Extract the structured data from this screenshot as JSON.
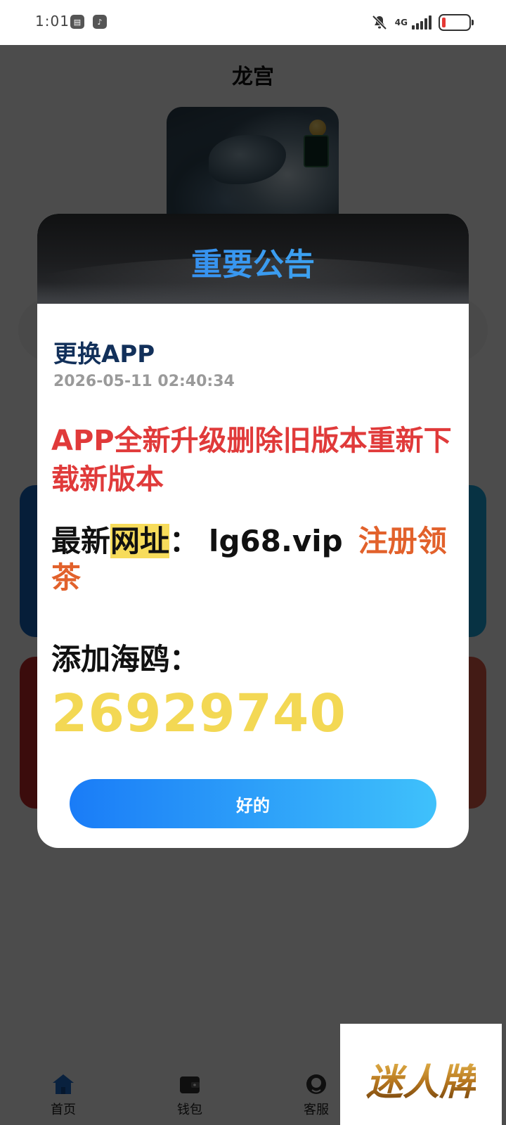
{
  "status_bar": {
    "time": "1:01",
    "app_icons": [
      "notes-app-icon",
      "tiktok-app-icon"
    ],
    "network": "4G",
    "icons": [
      "bell-off-icon",
      "signal-icon",
      "battery-low-icon"
    ]
  },
  "page": {
    "title": "龙宫"
  },
  "bottom_nav": {
    "items": [
      {
        "label": "首页",
        "icon": "home-icon",
        "active": true
      },
      {
        "label": "钱包",
        "icon": "wallet-icon",
        "active": false
      },
      {
        "label": "客服",
        "icon": "headset-icon",
        "active": false
      }
    ]
  },
  "dialog": {
    "title": "重要公告",
    "subject": "更换APP",
    "datetime": "2026-05-11 02:40:34",
    "headline": "APP全新升级删除旧版本重新下载新版本",
    "url_label_prefix": "最新",
    "url_label_highlight": "网址",
    "url_colon": "：",
    "url": "lg68.vip",
    "url_promo": "注册领茶",
    "contact_label": "添加海鸥：",
    "contact_number": "26929740",
    "ok_button": "好的"
  },
  "watermark": {
    "text": "迷人牌"
  },
  "colors": {
    "accent_blue": "#1a7cf7",
    "accent_cyan": "#3fc1fb",
    "headline_red": "#e03a3a",
    "promo_orange": "#e2612b",
    "number_yellow": "#f3d854",
    "highlight_yellow": "#f7dc5b",
    "subject_navy": "#12305a"
  }
}
